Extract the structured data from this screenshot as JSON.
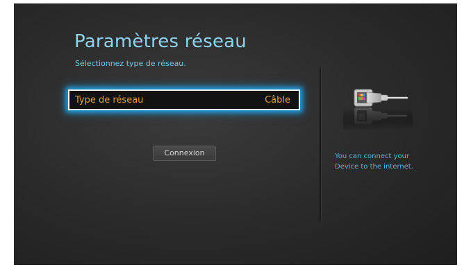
{
  "page": {
    "title": "Paramètres réseau",
    "subtitle": "Sélectionnez type de réseau."
  },
  "network_type": {
    "label": "Type de réseau",
    "value": "Câble"
  },
  "buttons": {
    "connect_label": "Connexion"
  },
  "help": {
    "line1": "You can connect your",
    "line2": "Device to the internet."
  },
  "icons": {
    "illustration": "ethernet-cable-icon"
  },
  "colors": {
    "title": "#8fd3f0",
    "selected_text": "#e8a43a",
    "focus_glow": "#1e9bdc",
    "help_text": "#59b6de"
  }
}
